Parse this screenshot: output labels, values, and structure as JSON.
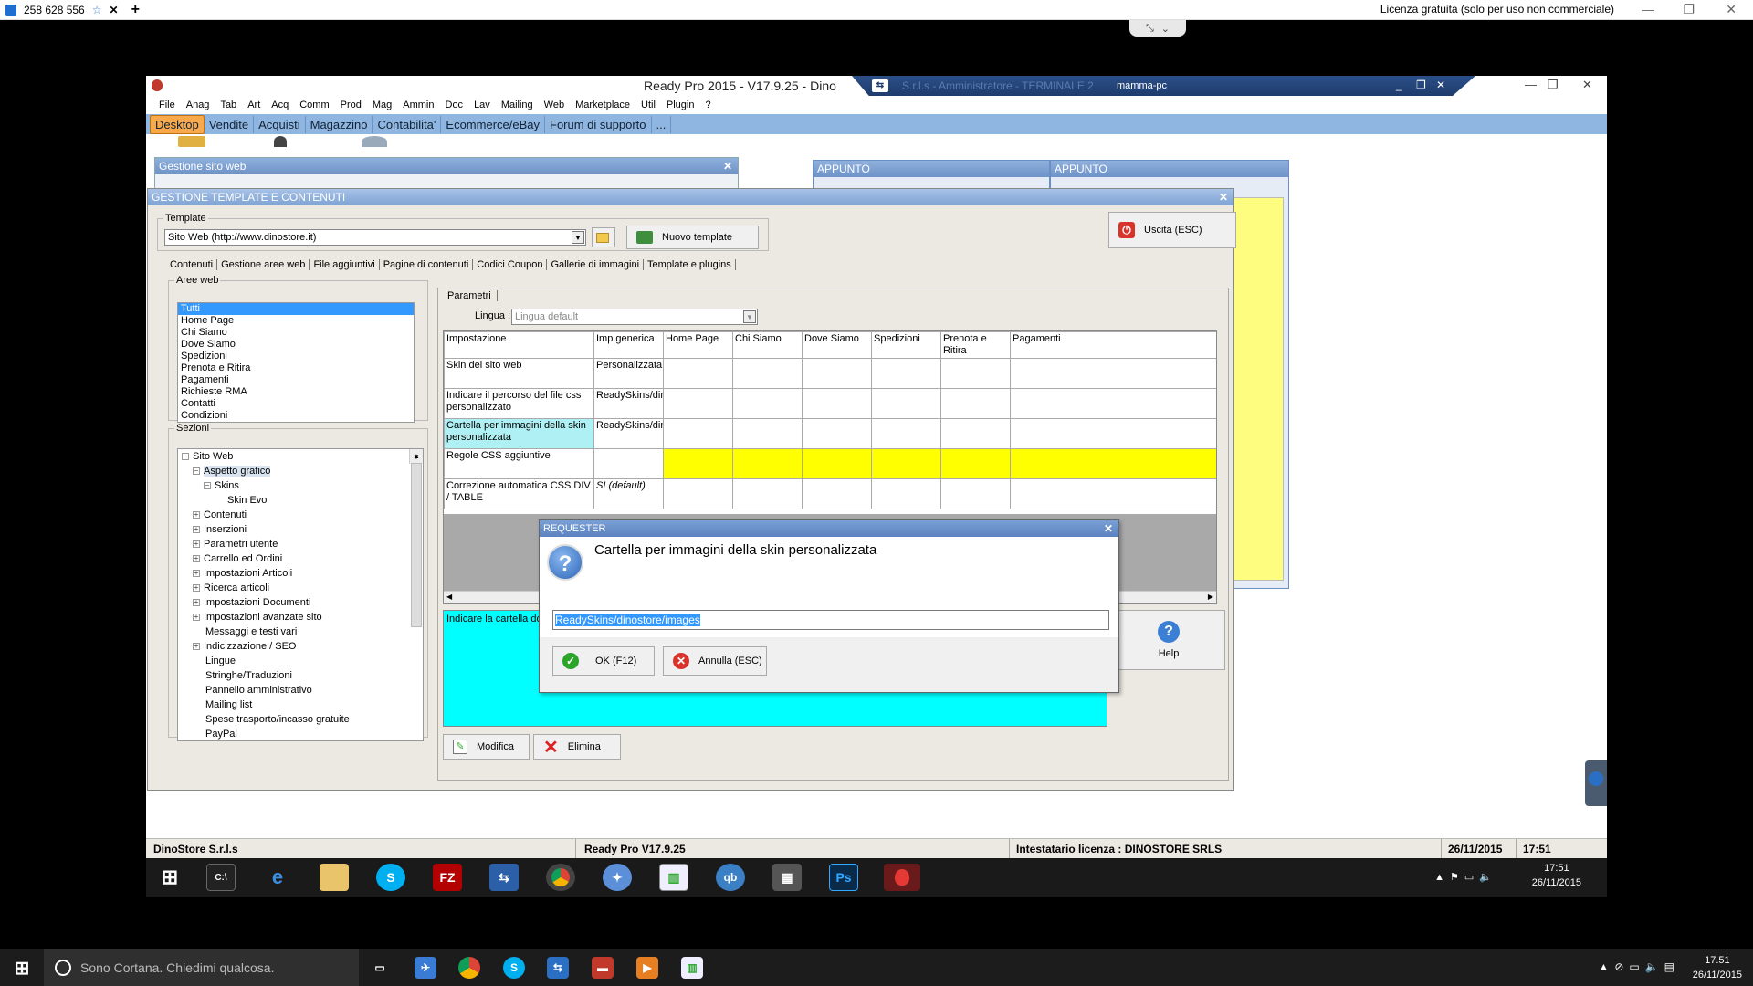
{
  "viewer": {
    "session_id": "258 628 556",
    "license_notice": "Licenza gratuita (solo per uso non commerciale)",
    "plus": "+",
    "close": "✕",
    "star": "☆"
  },
  "app": {
    "title": "Ready Pro 2015 - V17.9.25 - Dino",
    "tv_ghost_title": "S.r.l.s - Amministratore - TERMINALE 2",
    "tv_pc_name": "mamma-pc"
  },
  "menu": [
    "File",
    "Anag",
    "Tab",
    "Art",
    "Acq",
    "Comm",
    "Prod",
    "Mag",
    "Ammin",
    "Doc",
    "Lav",
    "Mailing",
    "Web",
    "Marketplace",
    "Util",
    "Plugin",
    "?"
  ],
  "tabs": [
    {
      "label": "Desktop",
      "active": true
    },
    {
      "label": "Vendite",
      "active": false
    },
    {
      "label": "Acquisti",
      "active": false
    },
    {
      "label": "Magazzino",
      "active": false
    },
    {
      "label": "Contabilita'",
      "active": false
    },
    {
      "label": "Ecommerce/eBay",
      "active": false
    },
    {
      "label": "Forum di supporto",
      "active": false
    },
    {
      "label": "...",
      "active": false
    }
  ],
  "bg_windows": {
    "sito_web_title": "Gestione sito web",
    "appunto1": "APPUNTO",
    "appunto2": "APPUNTO"
  },
  "main_window": {
    "title": "GESTIONE TEMPLATE E CONTENUTI",
    "template_legend": "Template",
    "template_value": "Sito Web (http://www.dinostore.it)",
    "new_template": "Nuovo template",
    "exit": "Uscita (ESC)",
    "subtabs": [
      "Contenuti",
      "Gestione aree web",
      "File aggiuntivi",
      "Pagine di contenuti",
      "Codici Coupon",
      "Gallerie di immagini",
      "Template e plugins"
    ],
    "aree_legend": "Aree web",
    "aree": [
      "Tutti",
      "Home Page",
      "Chi Siamo",
      "Dove Siamo",
      "Spedizioni",
      "Prenota e Ritira",
      "Pagamenti",
      "Richieste RMA",
      "Contatti",
      "Condizioni"
    ],
    "sezioni_legend": "Sezioni",
    "tree": [
      {
        "label": "Sito Web",
        "level": 0,
        "toggle": "−"
      },
      {
        "label": "Aspetto grafico",
        "level": 1,
        "toggle": "−",
        "sel": true
      },
      {
        "label": "Skins",
        "level": 2,
        "toggle": "−"
      },
      {
        "label": "Skin Evo",
        "level": 3,
        "toggle": ""
      },
      {
        "label": "Contenuti",
        "level": 1,
        "toggle": "+"
      },
      {
        "label": "Inserzioni",
        "level": 1,
        "toggle": "+"
      },
      {
        "label": "Parametri utente",
        "level": 1,
        "toggle": "+"
      },
      {
        "label": "Carrello ed Ordini",
        "level": 1,
        "toggle": "+"
      },
      {
        "label": "Impostazioni Articoli",
        "level": 1,
        "toggle": "+"
      },
      {
        "label": "Ricerca articoli",
        "level": 1,
        "toggle": "+"
      },
      {
        "label": "Impostazioni Documenti",
        "level": 1,
        "toggle": "+"
      },
      {
        "label": "Impostazioni avanzate sito",
        "level": 1,
        "toggle": "+"
      },
      {
        "label": "Messaggi e testi vari",
        "level": 1,
        "toggle": ""
      },
      {
        "label": "Indicizzazione / SEO",
        "level": 1,
        "toggle": "+"
      },
      {
        "label": "Lingue",
        "level": 1,
        "toggle": ""
      },
      {
        "label": "Stringhe/Traduzioni",
        "level": 1,
        "toggle": ""
      },
      {
        "label": "Pannello amministrativo",
        "level": 1,
        "toggle": ""
      },
      {
        "label": "Mailing list",
        "level": 1,
        "toggle": ""
      },
      {
        "label": "Spese trasporto/incasso gratuite",
        "level": 1,
        "toggle": ""
      },
      {
        "label": "PayPal",
        "level": 1,
        "toggle": ""
      }
    ],
    "param_tab": "Parametri",
    "lingua_label": "Lingua :",
    "lingua_value": "Lingua default",
    "grid_headers": [
      "Impostazione",
      "Imp.generica",
      "Home Page",
      "Chi Siamo",
      "Dove Siamo",
      "Spedizioni",
      "Prenota e Ritira",
      "Pagamenti"
    ],
    "grid_rows": [
      {
        "name": "Skin del sito web",
        "value": "Personalizzata",
        "style": ""
      },
      {
        "name": "Indicare il percorso del file css personalizzato",
        "value": "ReadySkins/dinostore/css",
        "style": ""
      },
      {
        "name": "Cartella per immagini della skin personalizzata",
        "value": "ReadySkins/dinostore/images",
        "style": "cyan"
      },
      {
        "name": "Regole CSS aggiuntive",
        "value": "",
        "style": "yellow"
      },
      {
        "name": "Correzione automatica CSS DIV / TABLE",
        "value": "SI (default)",
        "style": "italic"
      }
    ],
    "note_text": "Indicare la cartella dov ES: mySkin/images",
    "help": "Help",
    "modifica": "Modifica",
    "elimina": "Elimina"
  },
  "requester": {
    "title": "REQUESTER",
    "heading": "Cartella per immagini della skin personalizzata",
    "input_value": "ReadySkins/dinostore/images",
    "ok": "OK (F12)",
    "cancel": "Annulla (ESC)"
  },
  "status": {
    "company": "DinoStore S.r.l.s",
    "version": "Ready Pro V17.9.25",
    "license": "Intestatario licenza : DINOSTORE SRLS",
    "date": "26/11/2015",
    "time": "17:51"
  },
  "inner_clock": {
    "time": "17:51",
    "date": "26/11/2015"
  },
  "host": {
    "cortana": "Sono Cortana. Chiedimi qualcosa.",
    "time": "17.51",
    "date": "26/11/2015"
  },
  "colors": {
    "accent_tab": "#f7a94b",
    "tab_bar": "#8fb5e1",
    "cyan": "#00ffff",
    "yellow": "#ffff00"
  }
}
